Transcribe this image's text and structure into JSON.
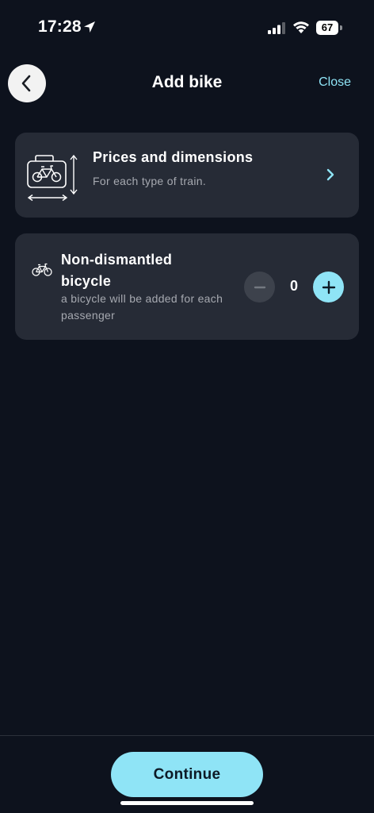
{
  "status_bar": {
    "time": "17:28",
    "battery": "67"
  },
  "header": {
    "title": "Add bike",
    "close_label": "Close"
  },
  "prices_card": {
    "title": "Prices and dimensions",
    "subtitle": "For each type of train."
  },
  "bike_card": {
    "title": "Non-dismantled bicycle",
    "description": "a bicycle will be added for each passenger",
    "quantity": "0"
  },
  "footer": {
    "continue_label": "Continue"
  },
  "colors": {
    "background": "#0d121d",
    "card": "#262b36",
    "accent": "#8fe4f6",
    "muted_text": "#a6a9b0"
  },
  "icons": {
    "back": "chevron-left-icon",
    "prices": "luggage-bike-dimensions-icon",
    "prices_chevron": "chevron-right-icon",
    "bike": "bicycle-icon",
    "minus": "minus-icon",
    "plus": "plus-icon"
  }
}
